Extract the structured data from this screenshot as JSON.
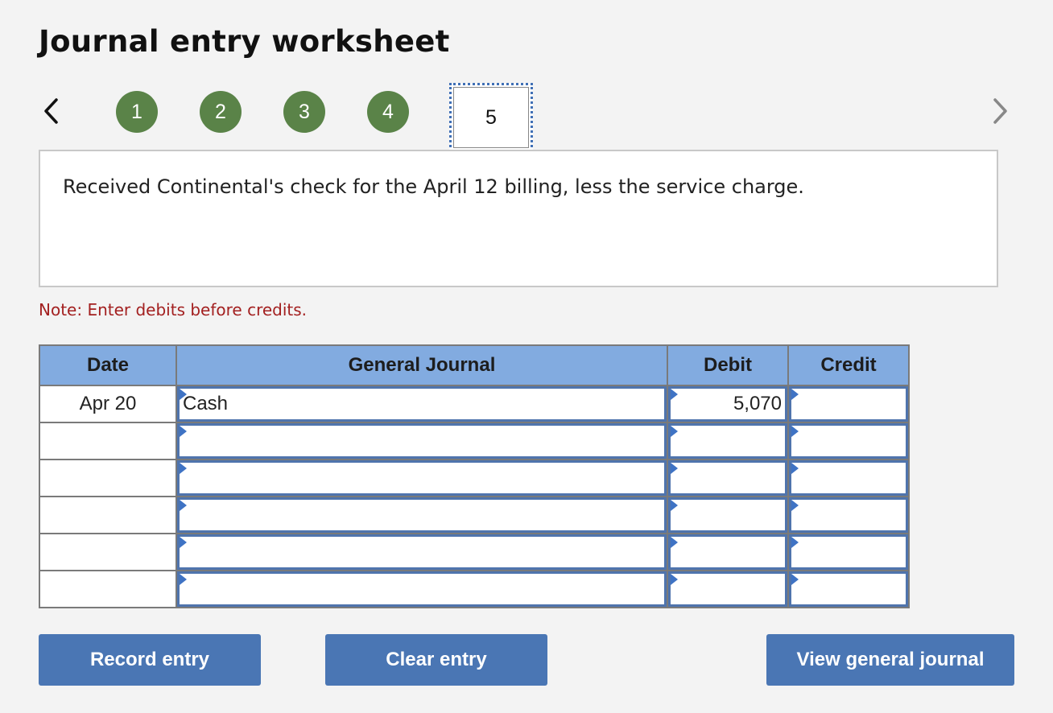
{
  "title": "Journal entry worksheet",
  "navigation": {
    "prev_icon": "chevron-left-icon",
    "next_icon": "chevron-right-icon",
    "steps": [
      "1",
      "2",
      "3",
      "4",
      "5"
    ],
    "current_step": "5",
    "completed_color": "#5a8348"
  },
  "description": "Received Continental's check for the April 12 billing, less the service charge.",
  "note": "Note: Enter debits before credits.",
  "journal": {
    "headers": {
      "date": "Date",
      "account": "General Journal",
      "debit": "Debit",
      "credit": "Credit"
    },
    "rows": [
      {
        "date": "Apr 20",
        "account": "Cash",
        "debit": "5,070",
        "credit": ""
      },
      {
        "date": "",
        "account": "",
        "debit": "",
        "credit": ""
      },
      {
        "date": "",
        "account": "",
        "debit": "",
        "credit": ""
      },
      {
        "date": "",
        "account": "",
        "debit": "",
        "credit": ""
      },
      {
        "date": "",
        "account": "",
        "debit": "",
        "credit": ""
      },
      {
        "date": "",
        "account": "",
        "debit": "",
        "credit": ""
      }
    ]
  },
  "buttons": {
    "record": "Record entry",
    "clear": "Clear entry",
    "view": "View general journal"
  }
}
